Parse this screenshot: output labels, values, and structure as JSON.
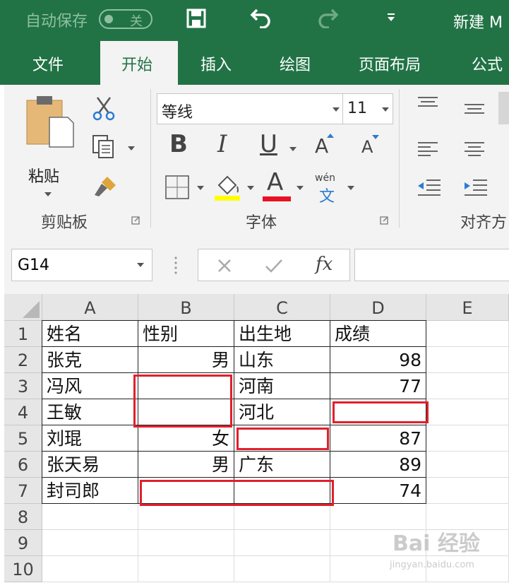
{
  "titlebar": {
    "autosave_label": "自动保存",
    "autosave_state": "关",
    "filename": "新建 M"
  },
  "tabs": [
    "文件",
    "开始",
    "插入",
    "绘图",
    "页面布局",
    "公式"
  ],
  "active_tab": "开始",
  "ribbon": {
    "clipboard": {
      "paste_label": "粘贴",
      "group_label": "剪贴板"
    },
    "font": {
      "font_name": "等线",
      "font_size": "11",
      "bold": "B",
      "italic": "I",
      "underline": "U",
      "grow": "A",
      "shrink": "A",
      "font_color_glyph": "A",
      "phonetic_top": "wén",
      "phonetic_bottom": "文",
      "group_label": "字体",
      "highlight_color": "#ffff00",
      "font_color": "#e81123"
    },
    "alignment": {
      "group_label": "对齐方"
    }
  },
  "formula_bar": {
    "name_box": "G14",
    "fx": "fx",
    "formula": ""
  },
  "sheet": {
    "columns": [
      "A",
      "B",
      "C",
      "D",
      "E"
    ],
    "rows": [
      "1",
      "2",
      "3",
      "4",
      "5",
      "6",
      "7",
      "8",
      "9",
      "10"
    ],
    "cells": {
      "A1": "姓名",
      "B1": "性别",
      "C1": "出生地",
      "D1": "成绩",
      "A2": "张克",
      "B2": "男",
      "C2": "山东",
      "D2": "98",
      "A3": "冯风",
      "B3": "",
      "C3": "河南",
      "D3": "77",
      "A4": "王敏",
      "B4": "",
      "C4": "河北",
      "D4": "",
      "A5": "刘琨",
      "B5": "女",
      "C5": "",
      "D5": "87",
      "A6": "张天易",
      "B6": "男",
      "C6": "广东",
      "D6": "89",
      "A7": "封司郎",
      "B7": "",
      "C7": "",
      "D7": "74"
    }
  },
  "annotation_color": "#e0202c",
  "watermark": {
    "main": "Bai 经验",
    "sub": "jingyan.baidu.com"
  }
}
